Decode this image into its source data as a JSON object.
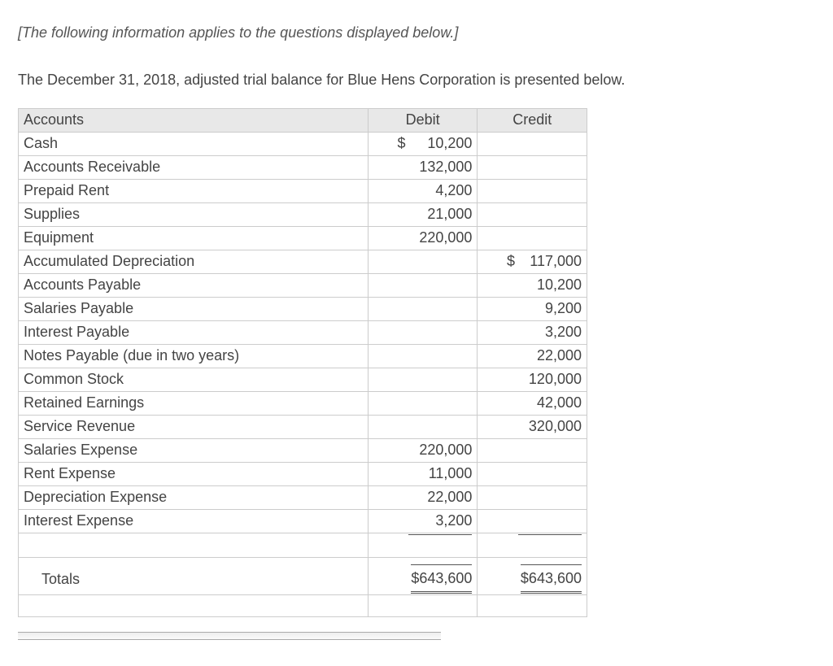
{
  "intro_note": "[The following information applies to the questions displayed below.]",
  "lead": "The December 31, 2018, adjusted trial balance for Blue Hens Corporation is presented below.",
  "headers": {
    "accounts": "Accounts",
    "debit": "Debit",
    "credit": "Credit"
  },
  "rows": [
    {
      "account": "Cash",
      "debit_cur": "$",
      "debit": "10,200",
      "credit_cur": "",
      "credit": ""
    },
    {
      "account": "Accounts Receivable",
      "debit_cur": "",
      "debit": "132,000",
      "credit_cur": "",
      "credit": ""
    },
    {
      "account": "Prepaid Rent",
      "debit_cur": "",
      "debit": "4,200",
      "credit_cur": "",
      "credit": ""
    },
    {
      "account": "Supplies",
      "debit_cur": "",
      "debit": "21,000",
      "credit_cur": "",
      "credit": ""
    },
    {
      "account": "Equipment",
      "debit_cur": "",
      "debit": "220,000",
      "credit_cur": "",
      "credit": ""
    },
    {
      "account": "Accumulated Depreciation",
      "debit_cur": "",
      "debit": "",
      "credit_cur": "$",
      "credit": "117,000"
    },
    {
      "account": "Accounts Payable",
      "debit_cur": "",
      "debit": "",
      "credit_cur": "",
      "credit": "10,200"
    },
    {
      "account": "Salaries Payable",
      "debit_cur": "",
      "debit": "",
      "credit_cur": "",
      "credit": "9,200"
    },
    {
      "account": "Interest Payable",
      "debit_cur": "",
      "debit": "",
      "credit_cur": "",
      "credit": "3,200"
    },
    {
      "account": "Notes Payable (due in two years)",
      "debit_cur": "",
      "debit": "",
      "credit_cur": "",
      "credit": "22,000"
    },
    {
      "account": "Common Stock",
      "debit_cur": "",
      "debit": "",
      "credit_cur": "",
      "credit": "120,000"
    },
    {
      "account": "Retained Earnings",
      "debit_cur": "",
      "debit": "",
      "credit_cur": "",
      "credit": "42,000"
    },
    {
      "account": "Service Revenue",
      "debit_cur": "",
      "debit": "",
      "credit_cur": "",
      "credit": "320,000"
    },
    {
      "account": "Salaries Expense",
      "debit_cur": "",
      "debit": "220,000",
      "credit_cur": "",
      "credit": ""
    },
    {
      "account": "Rent Expense",
      "debit_cur": "",
      "debit": "11,000",
      "credit_cur": "",
      "credit": ""
    },
    {
      "account": "Depreciation Expense",
      "debit_cur": "",
      "debit": "22,000",
      "credit_cur": "",
      "credit": ""
    },
    {
      "account": "Interest Expense",
      "debit_cur": "",
      "debit": "3,200",
      "credit_cur": "",
      "credit": ""
    }
  ],
  "totals": {
    "label": "Totals",
    "debit": "$643,600",
    "credit": "$643,600"
  }
}
